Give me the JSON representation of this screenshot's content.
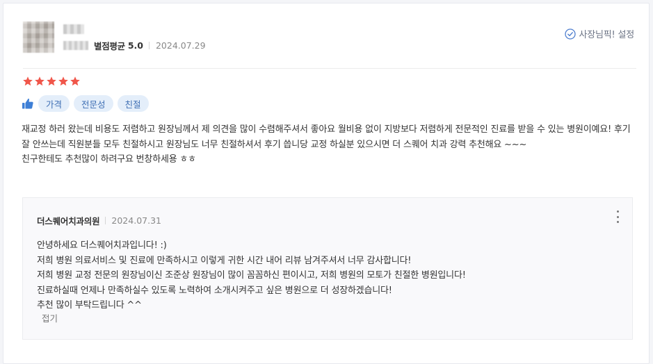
{
  "review": {
    "nickname": "익명",
    "user_id": "*****",
    "rating_label": "별점평균",
    "rating_value": "5.0",
    "date": "2024.07.29",
    "owner_pick_label": "사장님픽! 설정",
    "stars": 5,
    "tags": [
      "가격",
      "전문성",
      "친절"
    ],
    "body": "재교정 하러 왔는데 비용도 저렴하고 원장님께서 제 의견을 많이 수렴해주셔서 좋아요 월비용 없이 지방보다 저렴하게 전문적인 진료를 받을 수 있는 병원이예요! 후기 잘 안쓰는데 직원분들 모두 친절하시고 원장님도 너무 친절하셔서 후기 씁니당 교정 하실분 있으시면 더 스퀘어 치과 강력 추천해요 ~~~\n친구한테도 추천많이 하려구요 번창하세용 ㅎㅎ",
    "star_color": "#f0564a",
    "tag_color": "#3f6fb4"
  },
  "reply": {
    "author": "더스퀘어치과의원",
    "date": "2024.07.31",
    "body": "안녕하세요 더스퀘어치과입니다! :)\n저희 병원 의료서비스 및 진료에 만족하시고 이렇게 귀한 시간 내어 리뷰 남겨주셔서 너무 감사합니다!\n저희 병원 교정 전문의 원장님이신 조준상 원장님이 많이 꼼꼼하신 편이시고, 저희 병원의 모토가 친절한 병원입니다!\n진료하실때 언제나 만족하실수 있도록 노력하여 소개시켜주고 싶은 병원으로 더 성장하겠습니다!\n추천 많이 부탁드립니다 ^^",
    "collapse_label": "접기"
  }
}
